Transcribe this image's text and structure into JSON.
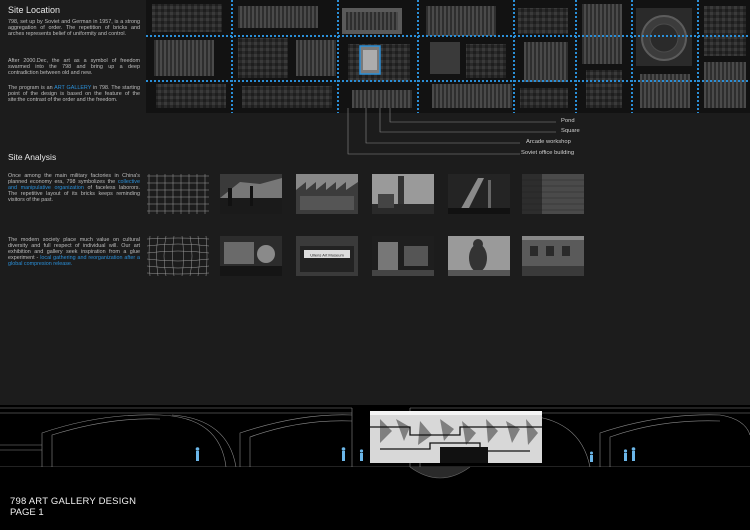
{
  "site_location": {
    "title": "Site Location",
    "p1": "798, set up by Soviet and German in 1957, is a strong aggregation of order. The repetition of bricks and arches represents belief of uniformity and control.",
    "p2": "After 2000.Dec, the art as a symbol of freedom swarmed into the 798 and bring up a deep contradiction between old and new.",
    "p3_pre": "The program is an ",
    "p3_highlight": "ART GALLERY",
    "p3_post": " in 798. The starting point of the design is based on the feature of the site:the contrast of the order and the freedom."
  },
  "map_labels": [
    "Pond",
    "Square",
    "Arcade workshop",
    "Soviet office building"
  ],
  "site_analysis": {
    "title": "Site Analysis",
    "p1_pre": "Once among the main military factories in China's planned economy era, 798 symbolizes the ",
    "p1_highlight": "collective and manipulative organization",
    "p1_post": " of faceless laborors. The repetitive layout of its bricks keeps reminding visitors of the past.",
    "p2_pre": "The modern society place much value on cultural diversity and full respect of individual will. Our art exhibition and gallery seek inspiration from a glue experiment - ",
    "p2_highlight": "local gathering and reorganization after a global compresion release.",
    "p2_post": ""
  },
  "photo_sign_text": "Ullens Art Museum",
  "footer": {
    "title": "798 ART GALLERY DESIGN",
    "page": "PAGE 1"
  },
  "colors": {
    "accent": "#2a8fd8",
    "background": "#1c1c1c"
  }
}
